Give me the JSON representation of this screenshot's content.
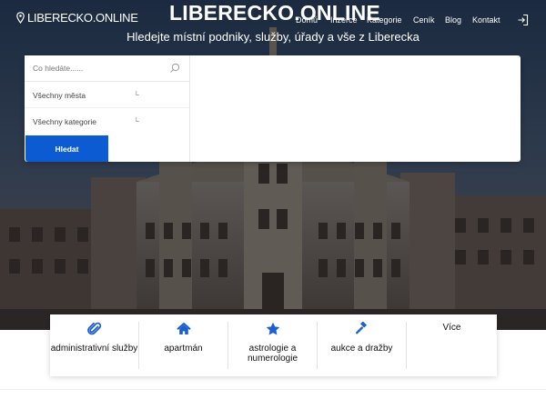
{
  "header": {
    "logo_text": "LIBERECKO.ONLINE",
    "nav": [
      "Domů",
      "Inzerce",
      "Kategorie",
      "Ceník",
      "Blog",
      "Kontakt"
    ],
    "login_icon": "login-icon"
  },
  "hero": {
    "title": "LIBERECKO.ONLINE",
    "subtitle": "Hledejte místní podniky, služby, úřady a vše z Liberecka"
  },
  "search": {
    "placeholder": "Co hledáte......",
    "city_select": "Všechny města",
    "category_select": "Všechny kategorie",
    "button_label": "Hledat"
  },
  "categories": {
    "items": [
      {
        "label": "administrativní služby",
        "icon": "paperclip-icon"
      },
      {
        "label": "apartmán",
        "icon": "home-icon"
      },
      {
        "label": "astrologie a numerologie",
        "icon": "star-icon"
      },
      {
        "label": "aukce a dražby",
        "icon": "gavel-icon"
      }
    ],
    "more_label": "Více"
  },
  "colors": {
    "primary": "#0c5bd3",
    "accent_icon": "#1a5fd0"
  }
}
